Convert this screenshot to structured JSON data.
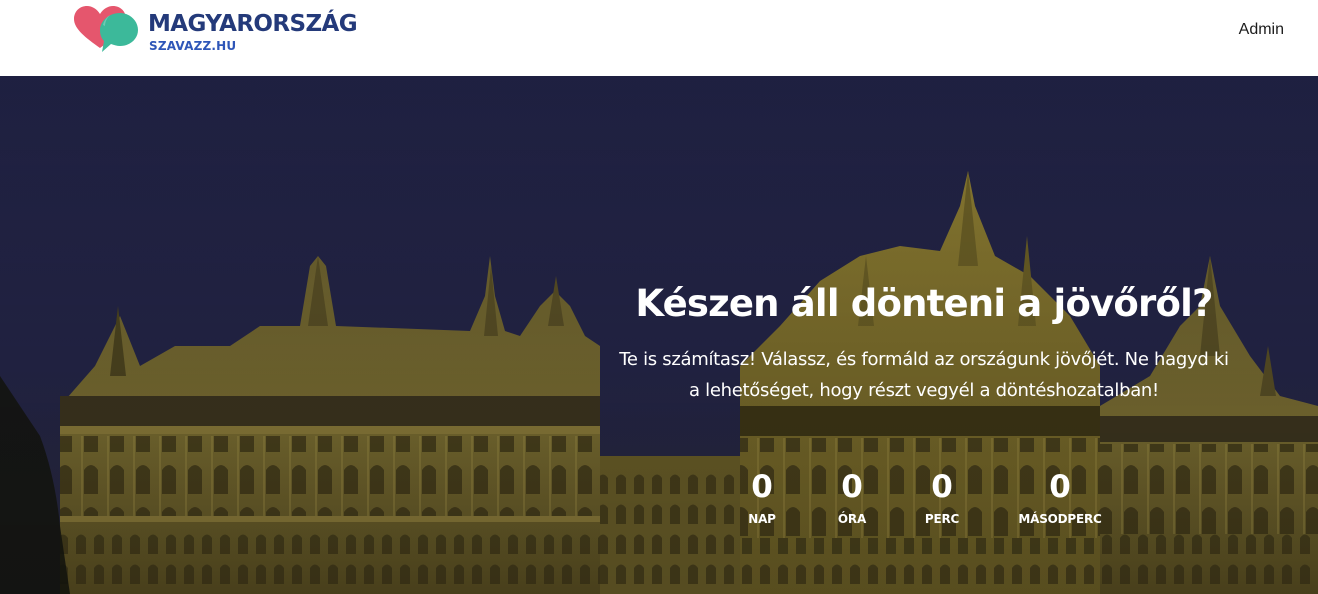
{
  "header": {
    "logo": {
      "title": "MAGYARORSZÁG",
      "subtitle": "SZAVAZZ.HU",
      "colors": {
        "title": "#243a7a",
        "subtitle": "#2e56b8",
        "heart": "#e5566d",
        "bubble": "#3cb99a"
      }
    },
    "nav": {
      "admin_label": "Admin"
    }
  },
  "hero": {
    "title": "Készen áll dönteni a jövőről?",
    "text": "Te is számítasz! Válassz, és formáld az országunk jövőjét. Ne hagyd ki a lehetőséget, hogy részt vegyél a döntéshozatalban!",
    "background_image": "hungarian-parliament-at-night",
    "countdown": [
      {
        "value": "0",
        "label": "NAP"
      },
      {
        "value": "0",
        "label": "ÓRA"
      },
      {
        "value": "0",
        "label": "PERC"
      },
      {
        "value": "0",
        "label": "MÁSODPERC"
      }
    ]
  }
}
